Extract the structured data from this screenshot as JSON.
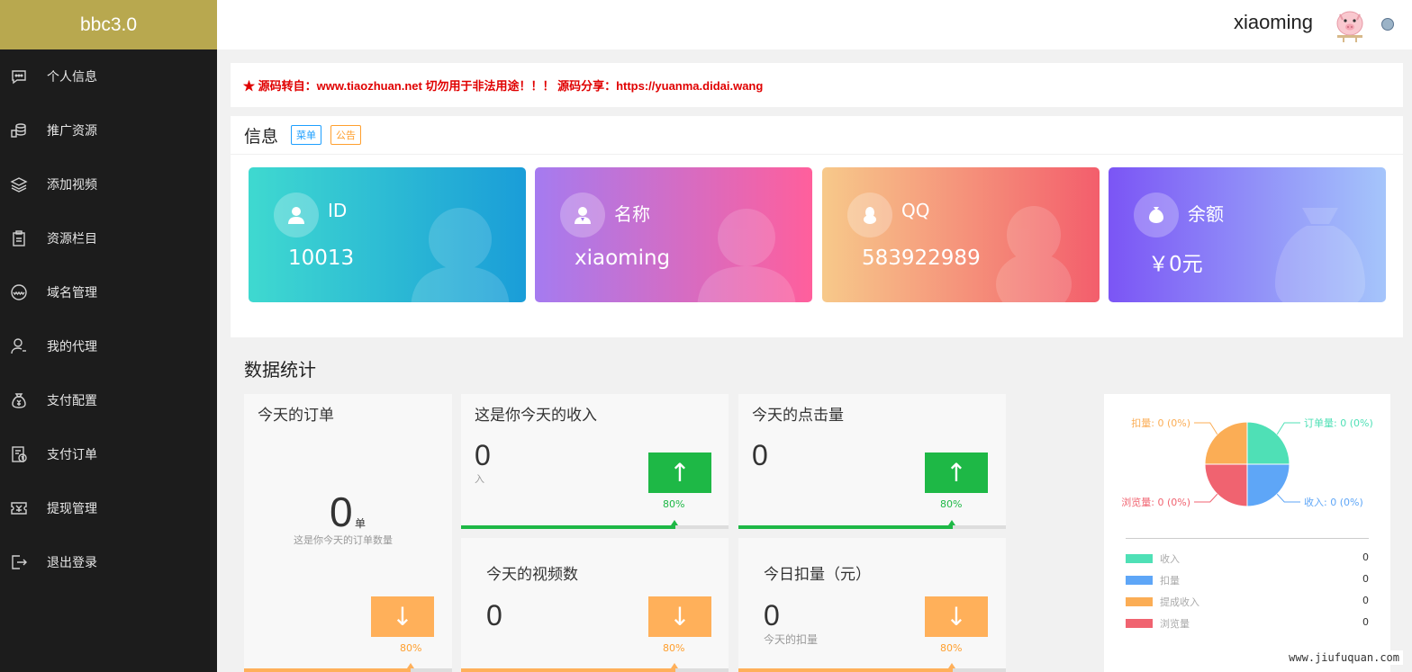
{
  "brand": "bbc3.0",
  "sidebar": {
    "items": [
      {
        "label": "个人信息",
        "icon": "chat-icon"
      },
      {
        "label": "推广资源",
        "icon": "coins-icon"
      },
      {
        "label": "添加视频",
        "icon": "layers-icon"
      },
      {
        "label": "资源栏目",
        "icon": "clipboard-icon"
      },
      {
        "label": "域名管理",
        "icon": "www-icon"
      },
      {
        "label": "我的代理",
        "icon": "user-icon"
      },
      {
        "label": "支付配置",
        "icon": "money-bag-icon"
      },
      {
        "label": "支付订单",
        "icon": "invoice-icon"
      },
      {
        "label": "提现管理",
        "icon": "ticket-icon"
      },
      {
        "label": "退出登录",
        "icon": "logout-icon"
      }
    ]
  },
  "header": {
    "username": "xiaoming"
  },
  "notice": {
    "text": "★ 源码转自：www.tiaozhuan.net 切勿用于非法用途！！！ 源码分享：https://yuanma.didai.wang"
  },
  "info": {
    "title": "信息",
    "tag_menu": "菜单",
    "tag_notice": "公告",
    "cards": [
      {
        "label": "ID",
        "value": "10013"
      },
      {
        "label": "名称",
        "value": "xiaoming"
      },
      {
        "label": "QQ",
        "value": "583922989"
      },
      {
        "label": "余额",
        "value": "￥0元"
      }
    ]
  },
  "stats": {
    "title": "数据统计",
    "orders": {
      "title": "今天的订单",
      "value": "0",
      "unit": "单",
      "sub": "这是你今天的订单数量",
      "pct": "80%"
    },
    "income": {
      "title": "这是你今天的收入",
      "value": "0",
      "sub": "入",
      "pct": "80%"
    },
    "clicks": {
      "title": "今天的点击量",
      "value": "0",
      "pct": "80%"
    },
    "videos": {
      "title": "今天的视频数",
      "value": "0",
      "pct": "80%"
    },
    "deduct": {
      "title": "今日扣量（元）",
      "value": "0",
      "sub": "今天的扣量",
      "pct": "80%"
    },
    "arrow_up": "↑",
    "arrow_down": "↓"
  },
  "chart_data": {
    "type": "pie",
    "title": "",
    "slices": [
      {
        "name": "订单量",
        "value": 0,
        "label": "订单量: 0 (0%)",
        "color": "#4fe0b6"
      },
      {
        "name": "收入",
        "value": 0,
        "label": "收入: 0 (0%)",
        "color": "#5ea6f7"
      },
      {
        "name": "浏览量",
        "value": 0,
        "label": "浏览量: 0 (0%)",
        "color": "#f06370"
      },
      {
        "name": "扣量",
        "value": 0,
        "label": "扣量: 0 (0%)",
        "color": "#fbad55"
      }
    ],
    "legend": [
      {
        "name": "收入",
        "value": "0",
        "color": "#4fe0b6"
      },
      {
        "name": "扣量",
        "value": "0",
        "color": "#5ea6f7"
      },
      {
        "name": "提成收入",
        "value": "0",
        "color": "#fbad55"
      },
      {
        "name": "浏览量",
        "value": "0",
        "color": "#f06370"
      }
    ]
  },
  "watermark": "www.jiufuquan.com"
}
